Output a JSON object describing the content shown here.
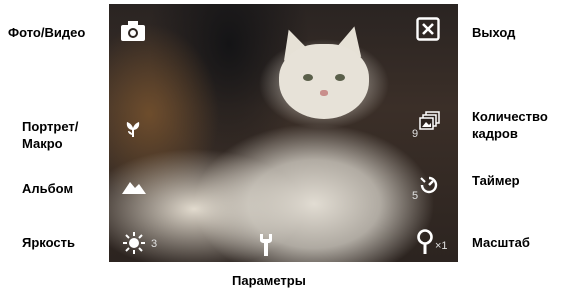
{
  "callouts": {
    "photo_video": "Фото/Видео",
    "portrait_macro": "Портрет/\nМакро",
    "album": "Альбом",
    "brightness": "Яркость",
    "parameters": "Параметры",
    "exit": "Выход",
    "frame_count": "Количество\nкадров",
    "timer": "Таймер",
    "zoom": "Масштаб"
  },
  "viewfinder": {
    "brightness_value": "3",
    "frame_count_value": "9",
    "timer_value": "5",
    "zoom_value": "×1"
  },
  "icons": {
    "camera": "camera-icon",
    "portrait_macro": "macro-flower-icon",
    "album": "mountains-icon",
    "brightness": "sun-icon",
    "settings": "wrench-icon",
    "exit": "close-icon",
    "frames": "stacked-frames-icon",
    "timer": "timer-icon",
    "zoom": "magnifier-icon"
  }
}
